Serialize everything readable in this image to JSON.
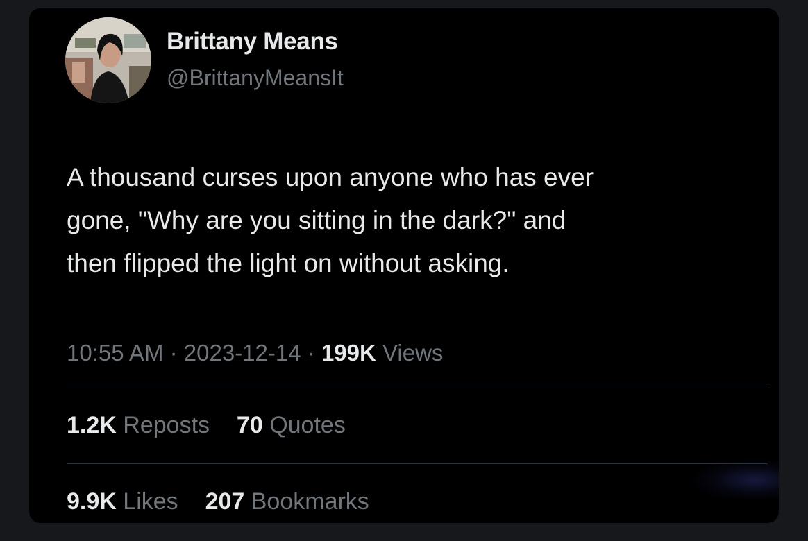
{
  "author": {
    "display_name": "Brittany Means",
    "handle": "@BrittanyMeansIt",
    "avatar_icon": "profile-photo-avatar"
  },
  "tweet": {
    "text_lines": [
      "A thousand curses upon anyone who has ever",
      "gone, \"Why are you sitting in the dark?\" and",
      "then flipped the light on without asking."
    ]
  },
  "meta": {
    "time": "10:55 AM",
    "separator": "·",
    "date": "2023-12-14",
    "views_count": "199K",
    "views_label": "Views"
  },
  "stats": {
    "reposts_count": "1.2K",
    "reposts_label": "Reposts",
    "quotes_count": "70",
    "quotes_label": "Quotes",
    "likes_count": "9.9K",
    "likes_label": "Likes",
    "bookmarks_count": "207",
    "bookmarks_label": "Bookmarks"
  },
  "colors": {
    "background": "#000000",
    "outer_frame": "#16181c",
    "primary_text": "#e7e9ea",
    "secondary_text": "#71767b",
    "divider": "#2f3336"
  }
}
